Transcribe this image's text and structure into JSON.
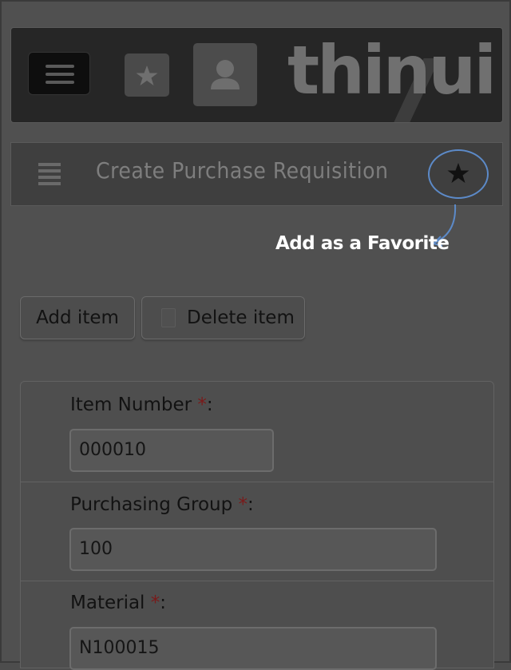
{
  "header": {
    "logo_text": "thinui",
    "menu_icon": "menu-icon",
    "favorites_icon": "star-icon",
    "user_icon": "user-icon"
  },
  "page": {
    "title": "Create Purchase Requisition",
    "favorite_icon": "star-icon",
    "annotation": "Add as a Favorite"
  },
  "toolbar": {
    "add_label": "Add item",
    "delete_label": "Delete item"
  },
  "form": {
    "required_marker": "*",
    "fields": [
      {
        "label": "Item Number",
        "value": "000010"
      },
      {
        "label": "Purchasing Group",
        "value": "100"
      },
      {
        "label": "Material",
        "value": "N100015"
      }
    ]
  },
  "colors": {
    "annotation_outline": "#5c8ac8",
    "required": "#7a1a1a"
  }
}
